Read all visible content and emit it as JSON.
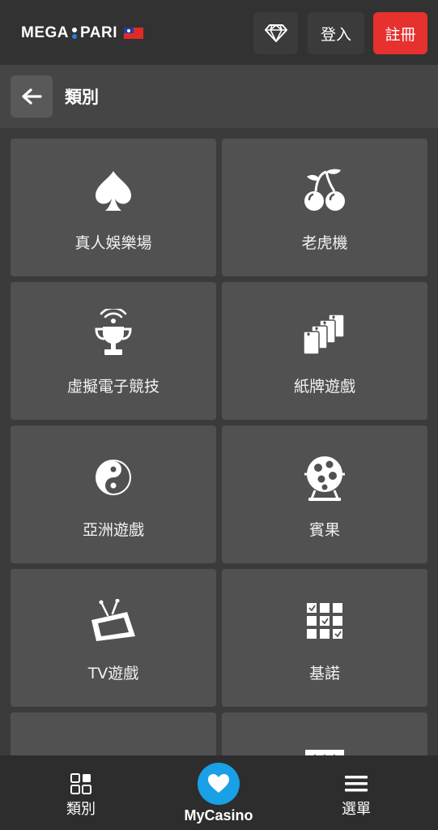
{
  "header": {
    "logo_left": "MEGA",
    "logo_right": "PARI",
    "login_label": "登入",
    "register_label": "註冊"
  },
  "titlebar": {
    "title": "類別"
  },
  "categories": [
    {
      "label": "真人娛樂場",
      "icon": "spade-icon"
    },
    {
      "label": "老虎機",
      "icon": "cherries-icon"
    },
    {
      "label": "虛擬電子競技",
      "icon": "trophy-icon"
    },
    {
      "label": "紙牌遊戲",
      "icon": "cards-icon"
    },
    {
      "label": "亞洲遊戲",
      "icon": "yin-yang-icon"
    },
    {
      "label": "賓果",
      "icon": "bingo-drum-icon"
    },
    {
      "label": "TV遊戲",
      "icon": "tv-icon"
    },
    {
      "label": "基諾",
      "icon": "keno-grid-icon"
    },
    {
      "label": "",
      "icon": "fish-icon"
    },
    {
      "label": "",
      "icon": "ticket-icon"
    }
  ],
  "bottom_nav": {
    "categories_label": "類別",
    "mycasino_label": "MyCasino",
    "menu_label": "選單"
  },
  "colors": {
    "header_bg": "#323232",
    "register_red": "#e6312f",
    "tile_bg": "#515151",
    "mycasino_blue": "#1aa0e6"
  }
}
